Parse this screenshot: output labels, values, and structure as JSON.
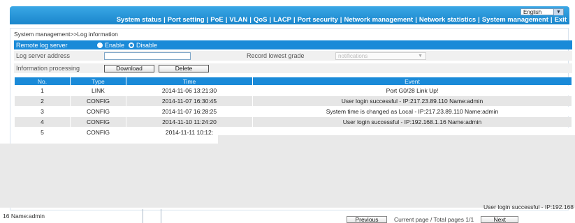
{
  "header": {
    "language": "English",
    "nav": [
      "System status",
      "Port setting",
      "PoE",
      "VLAN",
      "QoS",
      "LACP",
      "Port security",
      "Network management",
      "Network statistics",
      "System management",
      "Exit"
    ]
  },
  "breadcrumb": "System management>>Log information",
  "remote_log": {
    "label": "Remote log server",
    "enable": "Enable",
    "disable": "Disable",
    "selected": "Disable"
  },
  "log_server": {
    "label": "Log server address",
    "value": "",
    "grade_label": "Record lowest grade",
    "grade_value": "notifications"
  },
  "info_processing": {
    "label": "Information processing",
    "download": "Download",
    "delete": "Delete"
  },
  "table": {
    "headers": [
      "No.",
      "Type",
      "Time",
      "Event"
    ],
    "rows": [
      {
        "no": "1",
        "type": "LINK",
        "time": "2014-11-06 13:21:30",
        "event": "Port G0/28 Link Up!"
      },
      {
        "no": "2",
        "type": "CONFIG",
        "time": "2014-11-07 16:30:45",
        "event": "User login successful - IP:217.23.89.110 Name:admin"
      },
      {
        "no": "3",
        "type": "CONFIG",
        "time": "2014-11-07 16:28:25",
        "event": "System time is changed as Local - IP:217.23.89.110 Name:admin"
      },
      {
        "no": "4",
        "type": "CONFIG",
        "time": "2014-11-10 11:24:20",
        "event": "User login successful - IP:192.168.1.16 Name:admin"
      },
      {
        "no": "5",
        "type": "CONFIG",
        "time": "2014-11-11 10:12:",
        "event": ""
      }
    ]
  },
  "trailing_event": "User login successful - IP:192.168",
  "bottom_left_text": "16 Name:admin",
  "pager": {
    "previous": "Previous",
    "status": "Current page / Total pages 1/1",
    "next": "Next"
  }
}
